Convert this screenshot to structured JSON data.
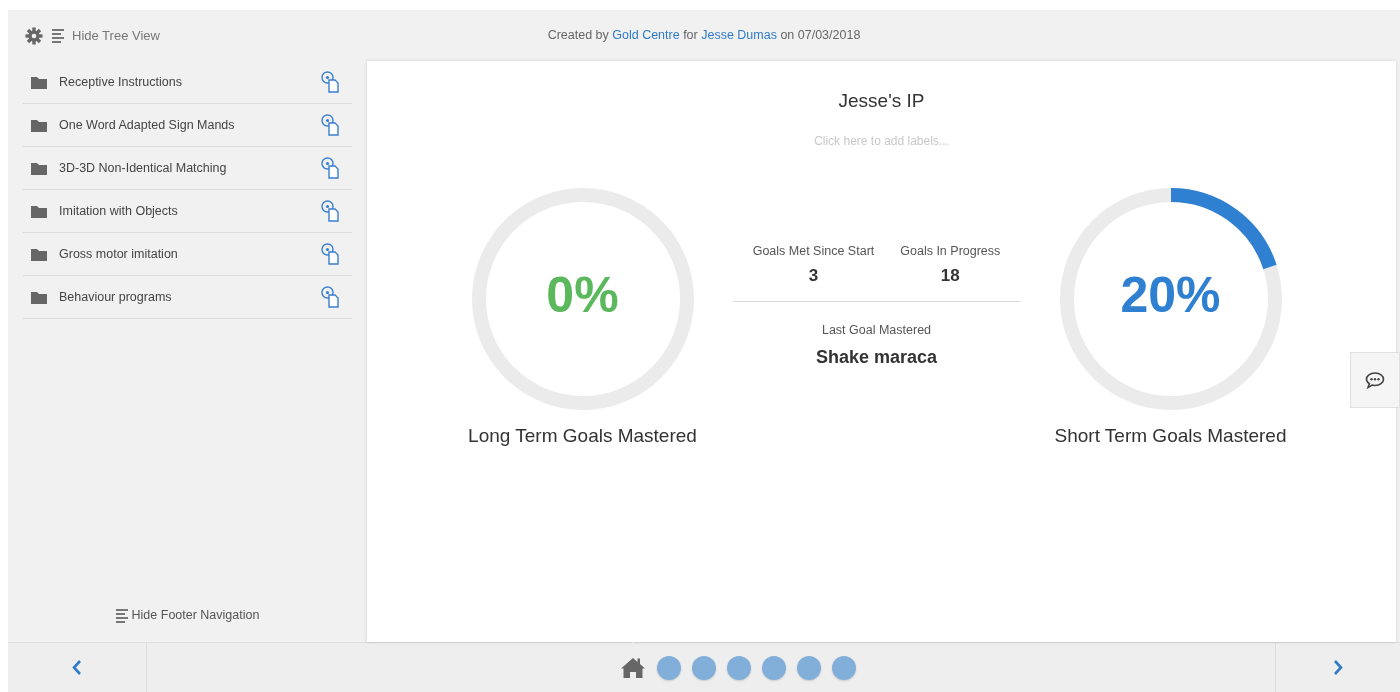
{
  "toolbar": {
    "toggle_label": "Hide Tree View"
  },
  "header": {
    "created_prefix": "Created by",
    "author": "Gold Centre",
    "for_word": "for",
    "student": "Jesse Dumas",
    "on_word": "on",
    "date": "07/03/2018"
  },
  "sidebar": {
    "items": [
      {
        "label": "Receptive Instructions"
      },
      {
        "label": "One Word Adapted Sign Mands"
      },
      {
        "label": "3D-3D Non-Identical Matching"
      },
      {
        "label": "Imitation with Objects"
      },
      {
        "label": "Gross motor imitation"
      },
      {
        "label": "Behaviour programs"
      }
    ],
    "footer_toggle": "Hide Footer Navigation"
  },
  "main": {
    "title": "Jesse's IP",
    "labels_placeholder": "Click here to add labels...",
    "rings": [
      {
        "value": "0%",
        "caption": "Long Term Goals Mastered",
        "color": "#5cb85c"
      },
      {
        "value": "20%",
        "caption": "Short Term Goals Mastered",
        "color": "#2f80d1"
      }
    ],
    "stats": [
      {
        "label": "Goals Met Since Start",
        "value": "3"
      },
      {
        "label": "Goals In Progress",
        "value": "18"
      }
    ],
    "last_goal": {
      "label": "Last Goal Mastered",
      "value": "Shake maraca"
    }
  },
  "footer": {
    "pages": [
      {
        "kind": "home",
        "selected": true
      },
      {
        "kind": "dot",
        "selected": false
      },
      {
        "kind": "dot",
        "selected": false
      },
      {
        "kind": "dot",
        "selected": false
      },
      {
        "kind": "dot",
        "selected": false
      },
      {
        "kind": "dot",
        "selected": false
      },
      {
        "kind": "dot",
        "selected": false
      }
    ]
  }
}
